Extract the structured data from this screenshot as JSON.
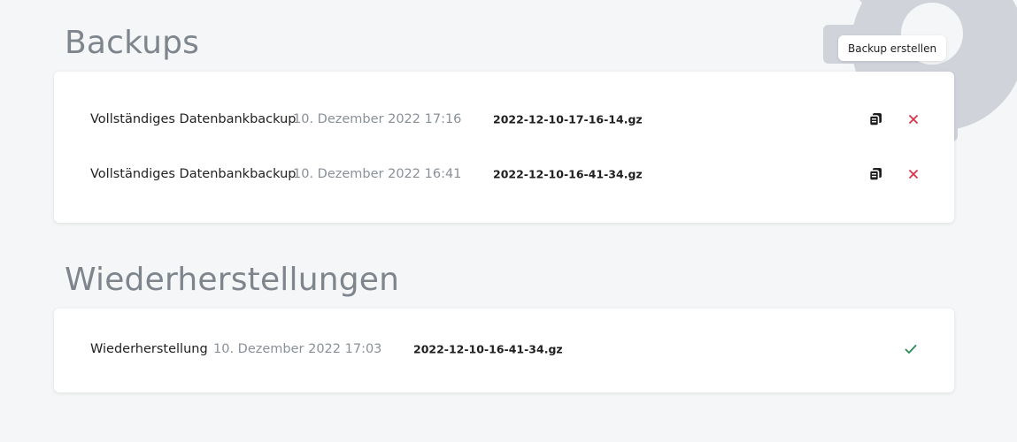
{
  "backups_section": {
    "title": "Backups",
    "create_button_label": "Backup erstellen",
    "items": [
      {
        "type": "Vollständiges Datenbankbackup",
        "date": "10. Dezember 2022 17:16",
        "file": "2022-12-10-17-16-14.gz",
        "copy_icon": "copy-icon",
        "delete_icon": "close-icon"
      },
      {
        "type": "Vollständiges Datenbankbackup",
        "date": "10. Dezember 2022 16:41",
        "file": "2022-12-10-16-41-34.gz",
        "copy_icon": "copy-icon",
        "delete_icon": "close-icon"
      }
    ]
  },
  "restores_section": {
    "title": "Wiederherstellungen",
    "items": [
      {
        "type": "Wiederherstellung",
        "date": "10. Dezember 2022 17:03",
        "file": "2022-12-10-16-41-34.gz",
        "status_icon": "checkmark-icon"
      }
    ]
  },
  "colors": {
    "background": "#f5f6f7",
    "heading": "#7e858d",
    "muted_text": "#8a9098",
    "delete": "#d9344a",
    "success": "#2e8b57",
    "decor_gear": "#d0d4da"
  }
}
